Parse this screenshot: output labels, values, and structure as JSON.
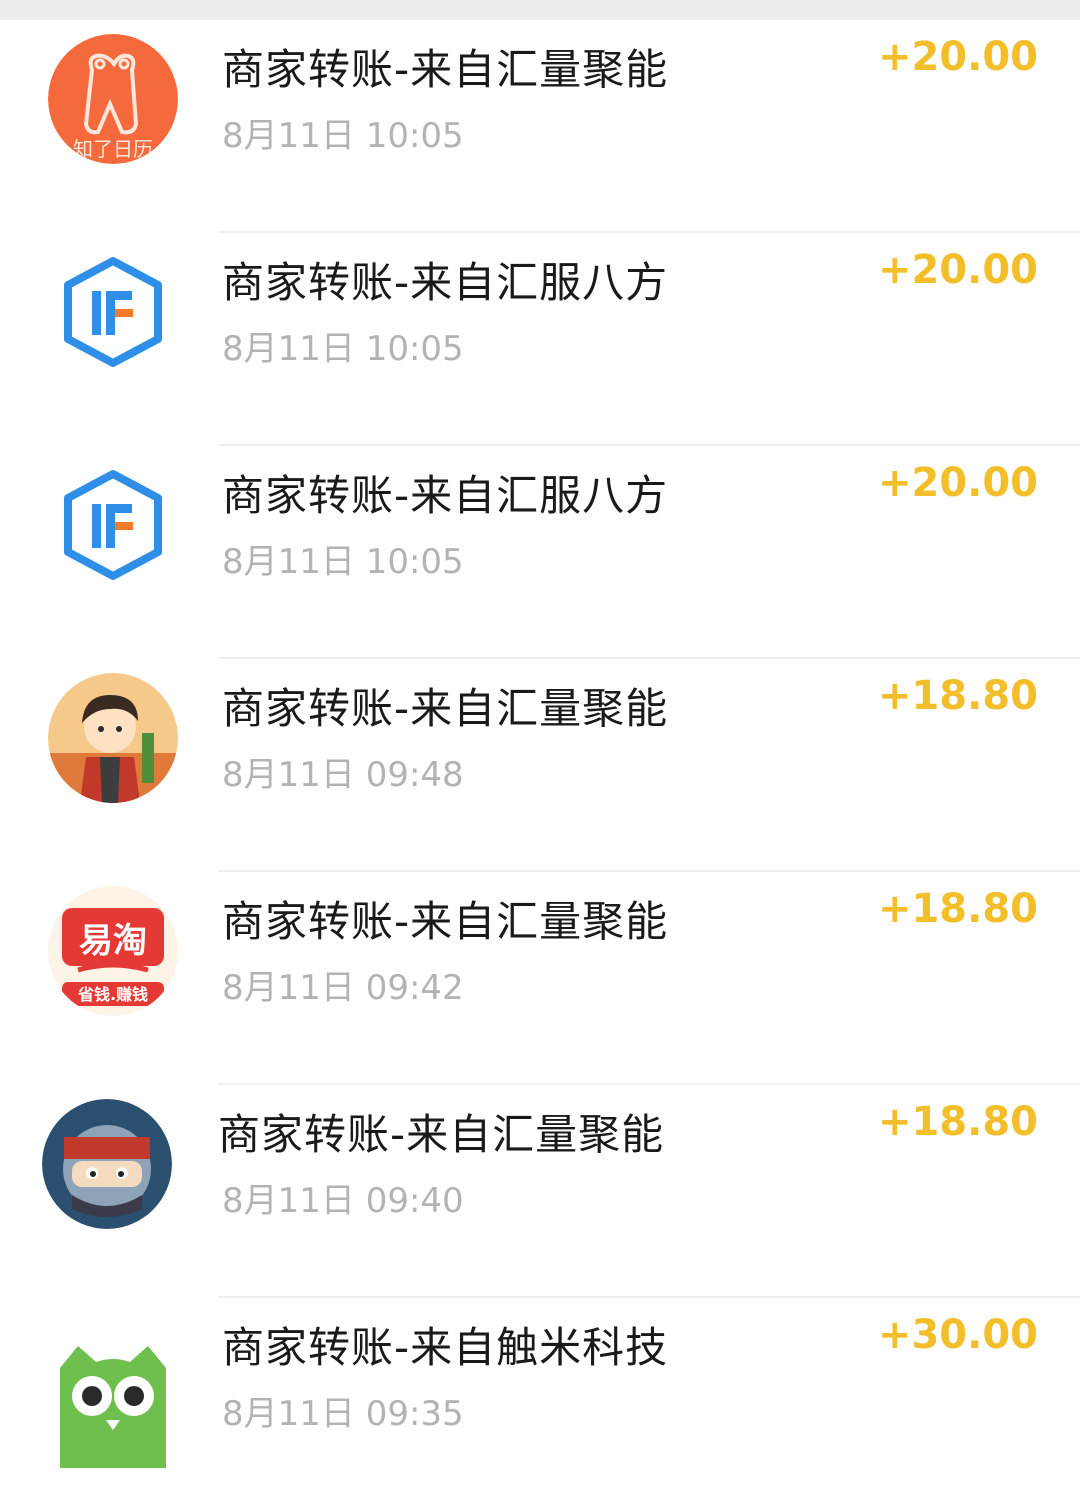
{
  "transactions": [
    {
      "title": "商家转账-来自汇量聚能",
      "time": "8月11日 10:05",
      "amount": "+20.00",
      "icon": "zhiliao-calendar-app-icon",
      "icon_text": "知了日历"
    },
    {
      "title": "商家转账-来自汇服八方",
      "time": "8月11日 10:05",
      "amount": "+20.00",
      "icon": "hf-hexagon-app-icon"
    },
    {
      "title": "商家转账-来自汇服八方",
      "time": "8月11日 10:05",
      "amount": "+20.00",
      "icon": "hf-hexagon-app-icon"
    },
    {
      "title": "商家转账-来自汇量聚能",
      "time": "8月11日 09:48",
      "amount": "+18.80",
      "icon": "cartoon-boy-app-icon"
    },
    {
      "title": "商家转账-来自汇量聚能",
      "time": "8月11日 09:42",
      "amount": "+18.80",
      "icon": "yitao-app-icon",
      "icon_text": "易淘",
      "icon_subtext": "省钱.赚钱"
    },
    {
      "title": "商家转账-来自汇量聚能",
      "time": "8月11日 09:40",
      "amount": "+18.80",
      "icon": "ninja-game-app-icon"
    },
    {
      "title": "商家转账-来自触米科技",
      "time": "8月11日 09:35",
      "amount": "+30.00",
      "icon": "green-owl-app-icon"
    }
  ],
  "colors": {
    "amount": "#f2bf2a",
    "title": "#1a1a1a",
    "time": "#b3b3b3",
    "hf_blue": "#2f8fe8",
    "hf_orange": "#f47b2a",
    "zhiliao_orange": "#f46a3c",
    "owl_green": "#6fbf4f"
  }
}
